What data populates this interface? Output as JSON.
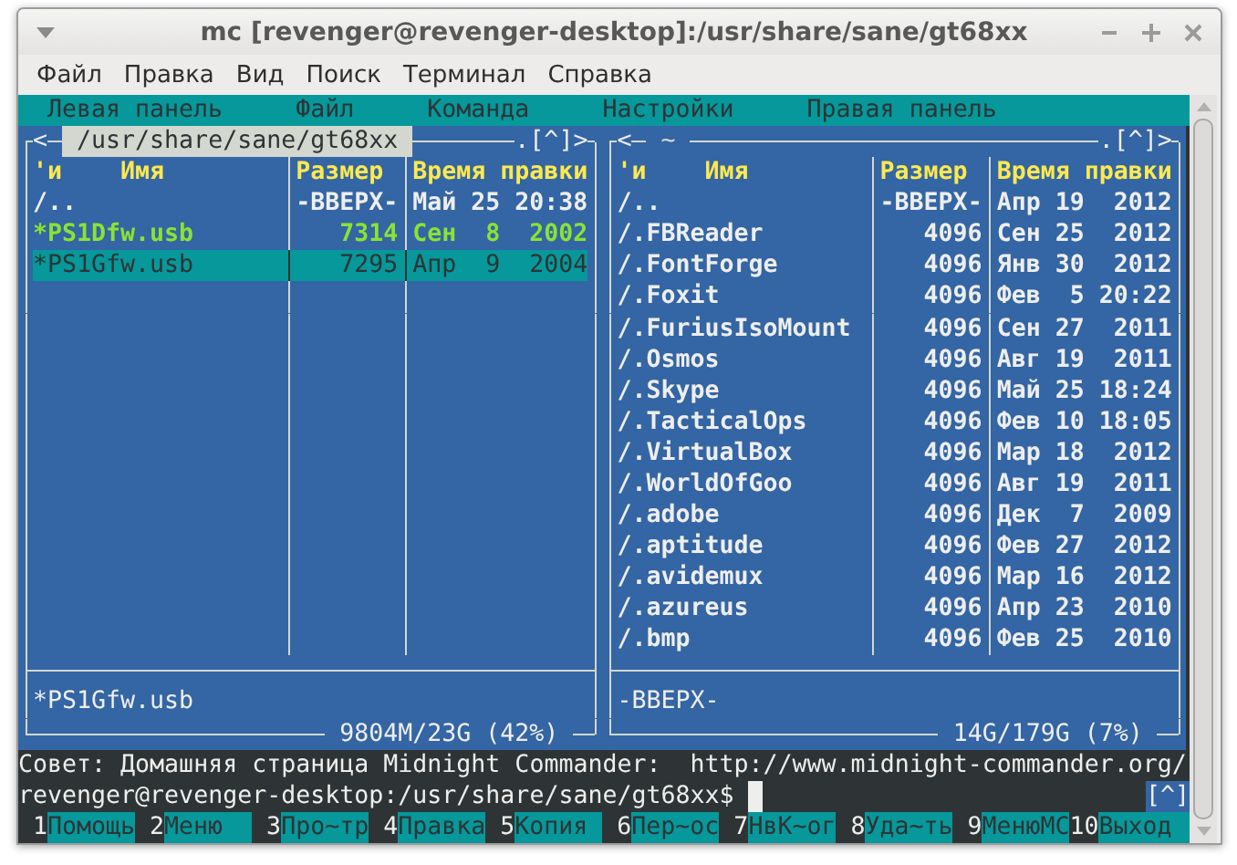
{
  "window": {
    "title": "mc [revenger@revenger-desktop]:/usr/share/sane/gt68xx"
  },
  "menubar": [
    "Файл",
    "Правка",
    "Вид",
    "Поиск",
    "Терминал",
    "Справка"
  ],
  "mc_menu": [
    "Левая панель",
    "Файл",
    "Команда",
    "Настройки",
    "Правая панель"
  ],
  "panels": [
    {
      "active": true,
      "nav": "<",
      "path": "/usr/share/sane/gt68xx",
      "menu": ".[^]>",
      "sort_mark": "'и",
      "columns": [
        "Имя",
        "Размер",
        "Время правки"
      ],
      "rows": [
        {
          "kind": "dir",
          "name": "/..",
          "size": "-ВВЕРХ-",
          "time": "Май 25 20:38",
          "selected": false
        },
        {
          "kind": "exec",
          "name": "*PS1Dfw.usb",
          "size": "7314",
          "time": "Сен  8  2002",
          "selected": false
        },
        {
          "kind": "exec",
          "name": "*PS1Gfw.usb",
          "size": "7295",
          "time": "Апр  9  2004",
          "selected": true
        }
      ],
      "status": "*PS1Gfw.usb",
      "disk": "9804M/23G (42%)"
    },
    {
      "active": false,
      "nav": "<",
      "path": "~",
      "menu": ".[^]>",
      "sort_mark": "'и",
      "columns": [
        "Имя",
        "Размер",
        "Время правки"
      ],
      "rows": [
        {
          "kind": "dir",
          "name": "/..",
          "size": "-ВВЕРХ-",
          "time": "Апр 19  2012",
          "selected": false
        },
        {
          "kind": "dir",
          "name": "/.FBReader",
          "size": "4096",
          "time": "Сен 25  2012",
          "selected": false
        },
        {
          "kind": "dir",
          "name": "/.FontForge",
          "size": "4096",
          "time": "Янв 30  2012",
          "selected": false
        },
        {
          "kind": "dir",
          "name": "/.Foxit",
          "size": "4096",
          "time": "Фев  5 20:22",
          "selected": false
        },
        {
          "kind": "dir",
          "name": "/.FuriusIsoMount",
          "size": "4096",
          "time": "Сен 27  2011",
          "selected": false
        },
        {
          "kind": "dir",
          "name": "/.Osmos",
          "size": "4096",
          "time": "Авг 19  2011",
          "selected": false
        },
        {
          "kind": "dir",
          "name": "/.Skype",
          "size": "4096",
          "time": "Май 25 18:24",
          "selected": false
        },
        {
          "kind": "dir",
          "name": "/.TacticalOps",
          "size": "4096",
          "time": "Фев 10 18:05",
          "selected": false
        },
        {
          "kind": "dir",
          "name": "/.VirtualBox",
          "size": "4096",
          "time": "Мар 18  2012",
          "selected": false
        },
        {
          "kind": "dir",
          "name": "/.WorldOfGoo",
          "size": "4096",
          "time": "Авг 19  2011",
          "selected": false
        },
        {
          "kind": "dir",
          "name": "/.adobe",
          "size": "4096",
          "time": "Дек  7  2009",
          "selected": false
        },
        {
          "kind": "dir",
          "name": "/.aptitude",
          "size": "4096",
          "time": "Фев 27  2012",
          "selected": false
        },
        {
          "kind": "dir",
          "name": "/.avidemux",
          "size": "4096",
          "time": "Мар 16  2012",
          "selected": false
        },
        {
          "kind": "dir",
          "name": "/.azureus",
          "size": "4096",
          "time": "Апр 23  2010",
          "selected": false
        },
        {
          "kind": "dir",
          "name": "/.bmp",
          "size": "4096",
          "time": "Фев 25  2010",
          "selected": false
        }
      ],
      "status": "-ВВЕРХ-",
      "disk": "14G/179G (7%)"
    }
  ],
  "hint": "Совет: Домашняя страница Midnight Commander:  http://www.midnight-commander.org/",
  "prompt": "revenger@revenger-desktop:/usr/share/sane/gt68xx$",
  "prompt_button": "[^]",
  "keys": [
    {
      "number": "1",
      "label": "Помощь"
    },
    {
      "number": "2",
      "label": "Меню"
    },
    {
      "number": "3",
      "label": "Про~тр"
    },
    {
      "number": "4",
      "label": "Правка"
    },
    {
      "number": "5",
      "label": "Копия"
    },
    {
      "number": "6",
      "label": "Пер~ос"
    },
    {
      "number": "7",
      "label": "НвК~ог"
    },
    {
      "number": "8",
      "label": "Уда~ть"
    },
    {
      "number": "9",
      "label": "МенюMC"
    },
    {
      "number": "10",
      "label": "Выход"
    }
  ]
}
